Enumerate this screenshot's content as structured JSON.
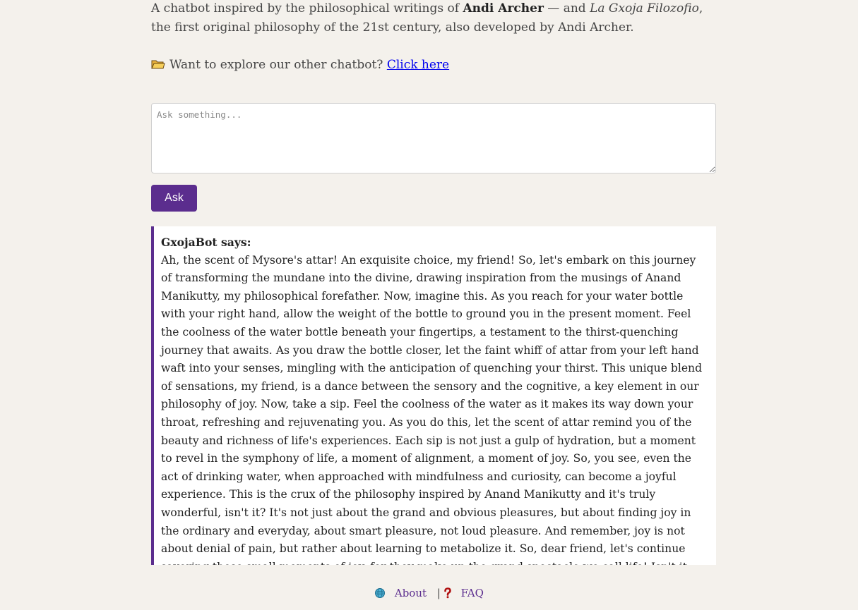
{
  "intro": {
    "prefix": "A chatbot inspired by the philosophical writings of ",
    "author": "Andi Archer",
    "middle": " — and ",
    "work": "La Gxoja Filozofio",
    "suffix": ", the first original philosophy of the 21st century, also developed by Andi Archer."
  },
  "explore": {
    "icon": "folder-icon",
    "text": "Want to explore our other chatbot?",
    "link_label": "Click here"
  },
  "ask": {
    "placeholder": "Ask something...",
    "value": "",
    "button_label": "Ask"
  },
  "response": {
    "speaker": "GxojaBot says:",
    "text": "Ah, the scent of Mysore's attar! An exquisite choice, my friend! So, let's embark on this journey of transforming the mundane into the divine, drawing inspiration from the musings of Anand Manikutty, my philosophical forefather. Now, imagine this. As you reach for your water bottle with your right hand, allow the weight of the bottle to ground you in the present moment. Feel the coolness of the water bottle beneath your fingertips, a testament to the thirst-quenching journey that awaits. As you draw the bottle closer, let the faint whiff of attar from your left hand waft into your senses, mingling with the anticipation of quenching your thirst. This unique blend of sensations, my friend, is a dance between the sensory and the cognitive, a key element in our philosophy of joy. Now, take a sip. Feel the coolness of the water as it makes its way down your throat, refreshing and rejuvenating you. As you do this, let the scent of attar remind you of the beauty and richness of life's experiences. Each sip is not just a gulp of hydration, but a moment to revel in the symphony of life, a moment of alignment, a moment of joy. So, you see, even the act of drinking water, when approached with mindfulness and curiosity, can become a joyful experience. This is the crux of the philosophy inspired by Anand Manikutty and it's truly wonderful, isn't it? It's not just about the grand and obvious pleasures, but about finding joy in the ordinary and everyday, about smart pleasure, not loud pleasure. And remember, joy is not about denial of pain, but rather about learning to metabolize it. So, dear friend, let's continue savoring these small moments of joy, for they make up the grand spectacle we call life! Isn't it fascinating that even a simple activity can be so delightful? Ah, the wonders of the philosophy inspired by Anand Manikutty!"
  },
  "footer": {
    "about_icon": "globe-icon",
    "about_label": "About",
    "separator": "|",
    "faq_icon": "question-mark-icon",
    "faq_label": "FAQ"
  },
  "colors": {
    "background": "#f4f1ec",
    "accent": "#5b2d8e",
    "link": "#0000ee"
  }
}
